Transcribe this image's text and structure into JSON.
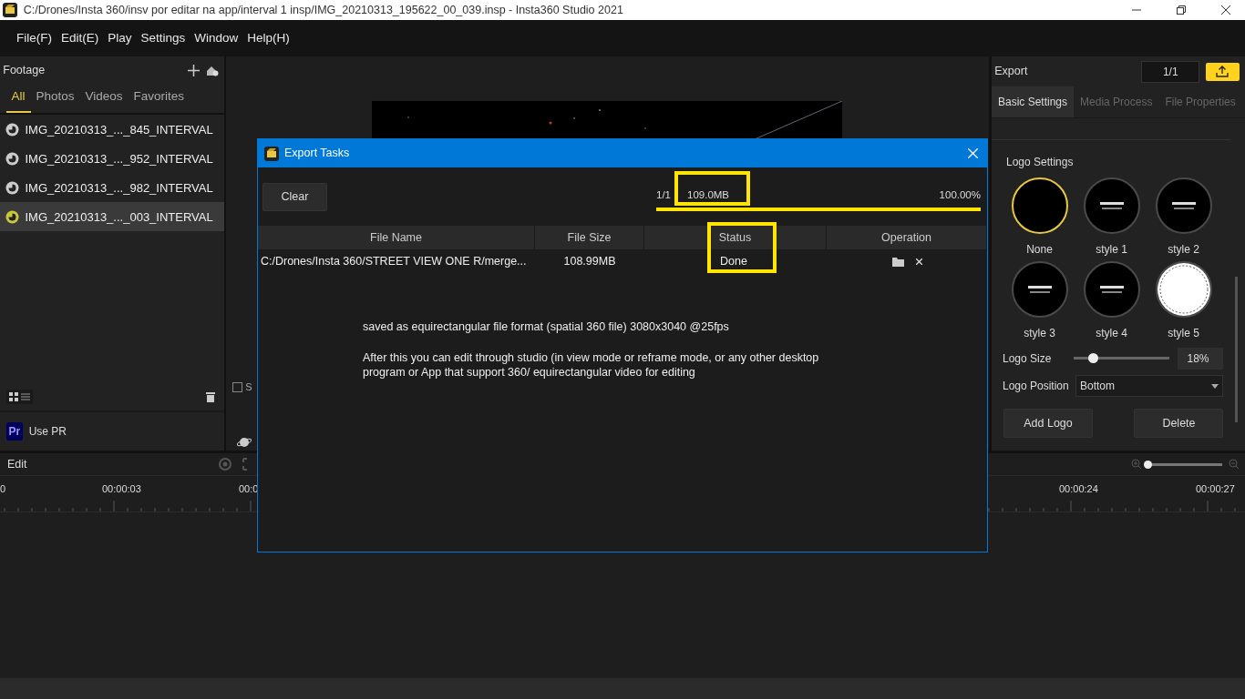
{
  "window": {
    "title": "C:/Drones/Insta 360/insv por editar na app/interval 1 insp/IMG_20210313_195622_00_039.insp - Insta360 Studio 2021"
  },
  "menu": [
    "File(F)",
    "Edit(E)",
    "Play",
    "Settings",
    "Window",
    "Help(H)"
  ],
  "footage": {
    "title": "Footage",
    "tabs": [
      {
        "label": "All",
        "selected": true
      },
      {
        "label": "Photos",
        "selected": false
      },
      {
        "label": "Videos",
        "selected": false
      },
      {
        "label": "Favorites",
        "selected": false
      }
    ],
    "items": [
      {
        "name": "IMG_20210313_..._845_INTERVAL",
        "selected": false
      },
      {
        "name": "IMG_20210313_..._952_INTERVAL",
        "selected": false
      },
      {
        "name": "IMG_20210313_..._982_INTERVAL",
        "selected": false
      },
      {
        "name": "IMG_20210313_..._003_INTERVAL",
        "selected": true
      }
    ],
    "use_pr": {
      "badge": "Pr",
      "label": "Use PR"
    }
  },
  "preview": {
    "checkbox_label": "S",
    "checked": false
  },
  "edit": {
    "title": "Edit",
    "ticks": [
      "0",
      "00:00:03",
      "00:0",
      "00:00:24",
      "00:00:27"
    ],
    "zoom": {
      "level": 0.0
    }
  },
  "export": {
    "title": "Export",
    "counter": "1/1",
    "tabs": [
      {
        "label": "Basic Settings",
        "selected": true
      },
      {
        "label": "Media Process",
        "selected": false
      },
      {
        "label": "File Properties",
        "selected": false
      }
    ],
    "logo_settings": {
      "title": "Logo Settings",
      "styles": [
        {
          "label": "None",
          "kind": "none",
          "selected": true
        },
        {
          "label": "style 1",
          "kind": "dark",
          "selected": false
        },
        {
          "label": "style 2",
          "kind": "dark",
          "selected": false
        },
        {
          "label": "style 3",
          "kind": "dark",
          "selected": false
        },
        {
          "label": "style 4",
          "kind": "dark",
          "selected": false
        },
        {
          "label": "style 5",
          "kind": "stamp",
          "selected": false
        }
      ],
      "size": {
        "label": "Logo Size",
        "level": 0.2,
        "value": "18%"
      },
      "position": {
        "label": "Logo Position",
        "value": "Bottom"
      },
      "buttons": [
        "Add Logo",
        "Delete"
      ]
    }
  },
  "dialog": {
    "title": "Export Tasks",
    "clear": "Clear",
    "count": "1/1",
    "size": "109.0MB",
    "percent": "100.00%",
    "progress": {
      "level": 1.0
    },
    "columns": [
      "File Name",
      "File Size",
      "Status",
      "Operation"
    ],
    "rows": [
      {
        "file_name": "C:/Drones/Insta 360/STREET VIEW ONE R/merge...",
        "file_size": "108.99MB",
        "status": "Done"
      }
    ],
    "notes": [
      "saved as equirectangular file format (spatial 360 file)  3080x3040 @25fps",
      "After this you can edit through studio (in view mode or reframe mode, or any other desktop program or App that support 360/ equirectangular video for editing"
    ]
  }
}
